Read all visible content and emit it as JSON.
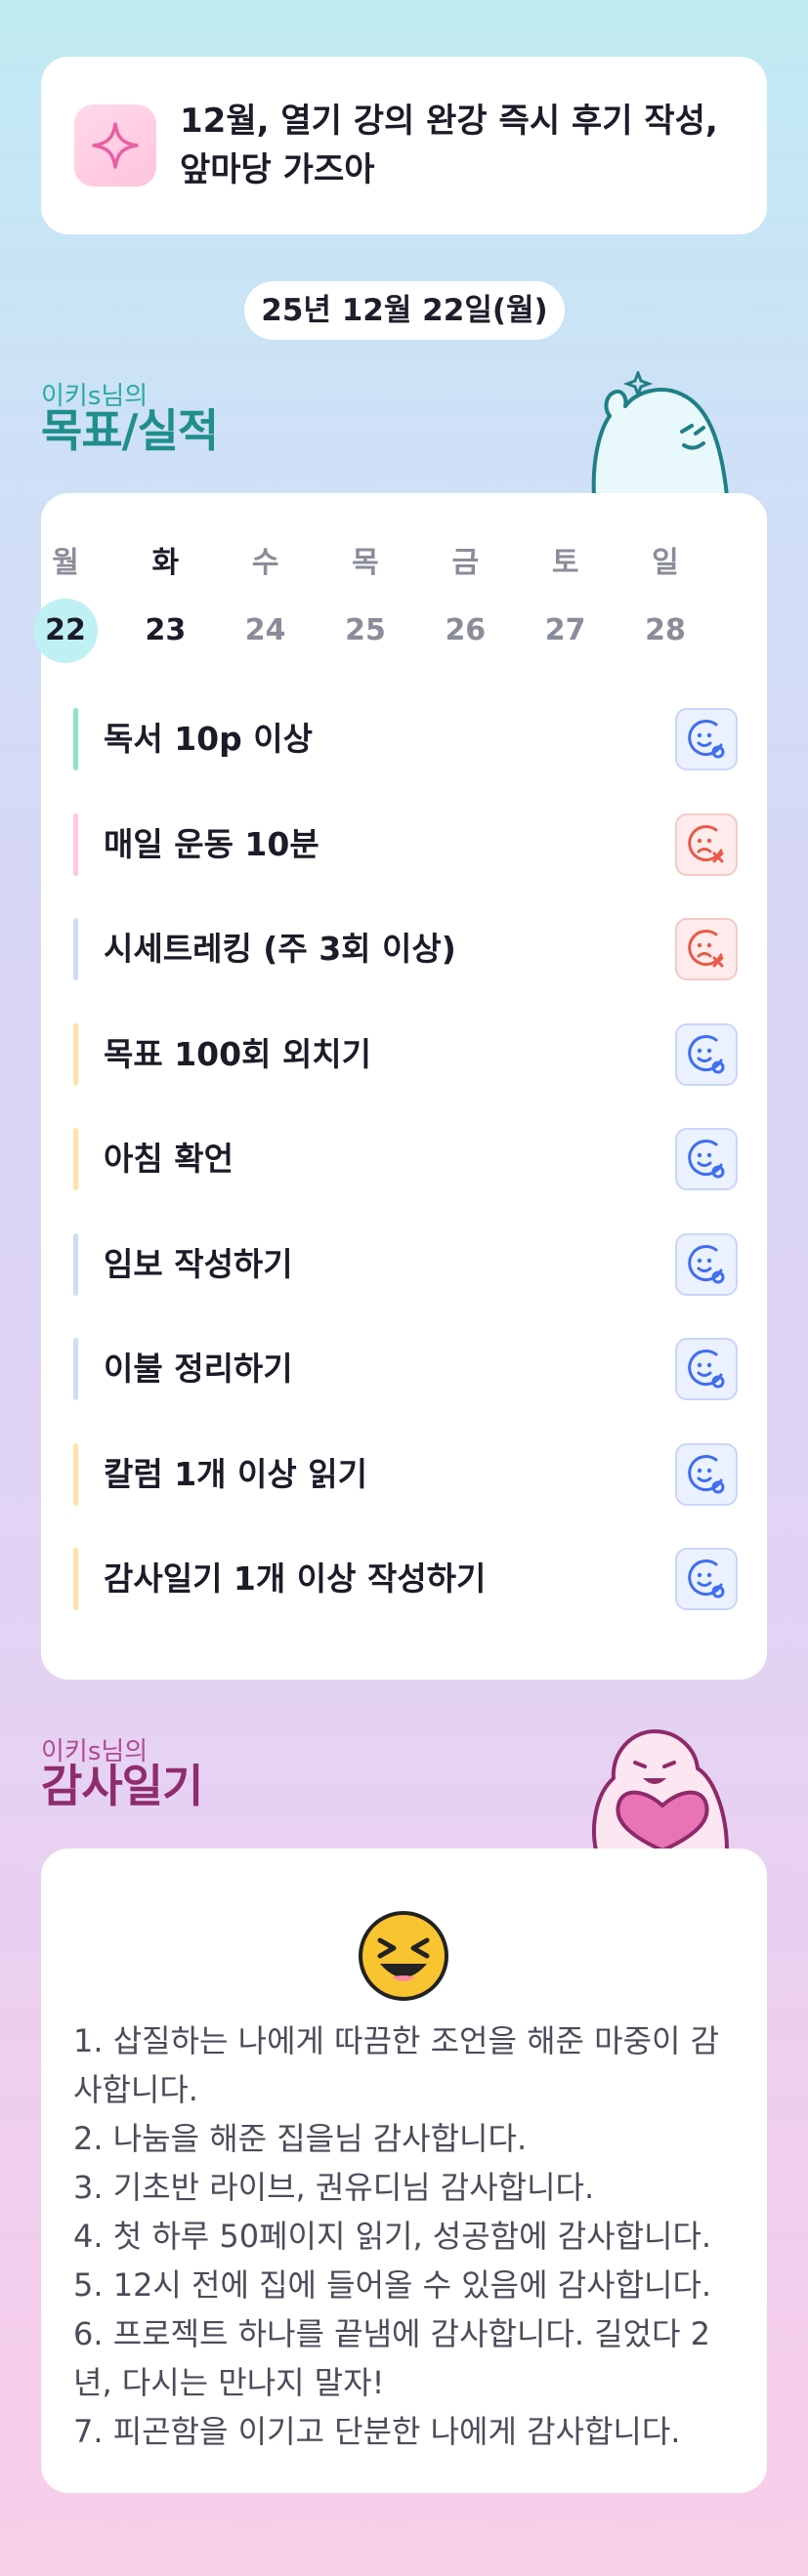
{
  "banner": {
    "icon": "sparkle-icon",
    "text": "12월, 열기 강의 완강 즉시 후기 작성, 앞마당 가즈아"
  },
  "date": "25년 12월 22일(월)",
  "goals_section": {
    "owner": "이키s님의",
    "title": "목표/실적",
    "mascot": "waving-mascot"
  },
  "week": {
    "days": [
      "월",
      "화",
      "수",
      "목",
      "금",
      "토",
      "일"
    ],
    "dates": [
      "22",
      "23",
      "24",
      "25",
      "26",
      "27",
      "28"
    ],
    "selected_index": 0
  },
  "goals": [
    {
      "label": "독서 10p 이상",
      "status": "success",
      "bar_color": "#8ee3c6"
    },
    {
      "label": "매일 운동 10분",
      "status": "fail",
      "bar_color": "#ffc6e1"
    },
    {
      "label": "시세트레킹 (주 3회 이상)",
      "status": "fail",
      "bar_color": "#cfdcf7"
    },
    {
      "label": "목표 100회 외치기",
      "status": "success",
      "bar_color": "#ffe2a6"
    },
    {
      "label": "아침 확언",
      "status": "success",
      "bar_color": "#ffe2a6"
    },
    {
      "label": "임보 작성하기",
      "status": "success",
      "bar_color": "#cfdcf7"
    },
    {
      "label": "이불 정리하기",
      "status": "success",
      "bar_color": "#cfdcf7"
    },
    {
      "label": "칼럼 1개 이상 읽기",
      "status": "success",
      "bar_color": "#ffe2a6"
    },
    {
      "label": "감사일기 1개 이상 작성하기",
      "status": "success",
      "bar_color": "#ffe2a6"
    }
  ],
  "thanks_section": {
    "owner": "이키s님의",
    "title": "감사일기",
    "mascot": "heart-mascot",
    "mood": "laughing-emoji"
  },
  "thanks": [
    "1. 삽질하는 나에게 따끔한 조언을 해준 마중이 감사합니다.",
    "2. 나눔을 해준 집을님 감사합니다.",
    "3. 기초반 라이브, 권유디님 감사합니다.",
    "4. 첫 하루 50페이지 읽기, 성공함에 감사합니다.",
    "5. 12시 전에 집에 들어올 수 있음에 감사합니다.",
    "6. 프로젝트 하나를 끝냄에 감사합니다. 길었다 2년, 다시는 만나지 말자!",
    "7. 피곤함을 이기고 단분한 나에게 감사합니다."
  ],
  "colors": {
    "success": "#3f6ef0",
    "fail": "#e85a4a",
    "today": "#bff0f4"
  }
}
